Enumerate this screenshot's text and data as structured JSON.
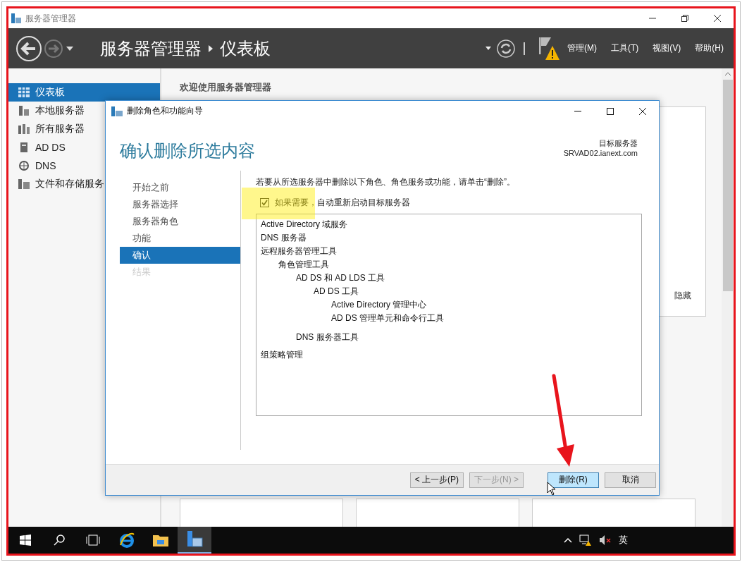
{
  "window": {
    "title": "服务器管理器"
  },
  "header": {
    "breadcrumb": [
      "服务器管理器",
      "仪表板"
    ],
    "menus": [
      "管理(M)",
      "工具(T)",
      "视图(V)",
      "帮助(H)"
    ]
  },
  "sidebar": {
    "items": [
      {
        "label": "仪表板",
        "kind": "dashboard",
        "selected": true
      },
      {
        "label": "本地服务器",
        "kind": "server",
        "selected": false
      },
      {
        "label": "所有服务器",
        "kind": "servers",
        "selected": false
      },
      {
        "label": "AD DS",
        "kind": "directory",
        "selected": false
      },
      {
        "label": "DNS",
        "kind": "dns",
        "selected": false
      },
      {
        "label": "文件和存储服务",
        "kind": "storage",
        "selected": false
      }
    ]
  },
  "main": {
    "welcome": "欢迎使用服务器管理器",
    "hide_link": "隐藏"
  },
  "dialog": {
    "title": "删除角色和功能向导",
    "heading": "确认删除所选内容",
    "target_label": "目标服务器",
    "target_server": "SRVAD02.ianext.com",
    "steps": [
      {
        "label": "开始之前",
        "selected": false,
        "disabled": false
      },
      {
        "label": "服务器选择",
        "selected": false,
        "disabled": false
      },
      {
        "label": "服务器角色",
        "selected": false,
        "disabled": false
      },
      {
        "label": "功能",
        "selected": false,
        "disabled": false
      },
      {
        "label": "确认",
        "selected": true,
        "disabled": false
      },
      {
        "label": "结果",
        "selected": false,
        "disabled": true
      }
    ],
    "instruction": "若要从所选服务器中删除以下角色、角色服务或功能，请单击“删除”。",
    "restart": {
      "label": "如果需要，自动重新启动目标服务器",
      "checked": true
    },
    "items": [
      {
        "label": "Active Directory 域服务"
      },
      {
        "label": "DNS 服务器"
      },
      {
        "label": "远程服务器管理工具",
        "children": [
          {
            "label": "角色管理工具",
            "children": [
              {
                "label": "AD DS 和 AD LDS 工具",
                "children": [
                  {
                    "label": "AD DS 工具",
                    "children": [
                      {
                        "label": "Active Directory 管理中心"
                      },
                      {
                        "label": "AD DS 管理单元和命令行工具"
                      }
                    ]
                  }
                ]
              },
              {
                "label": "DNS 服务器工具"
              }
            ]
          }
        ]
      },
      {
        "label": "组策略管理"
      }
    ],
    "buttons": [
      {
        "label": "< 上一步(P)",
        "disabled": false,
        "primary": false
      },
      {
        "label": "下一步(N) >",
        "disabled": true,
        "primary": false
      },
      {
        "label": "删除(R)",
        "disabled": false,
        "primary": true
      },
      {
        "label": "取消",
        "disabled": false,
        "primary": false
      }
    ]
  },
  "taskbar": {
    "language": "英"
  }
}
